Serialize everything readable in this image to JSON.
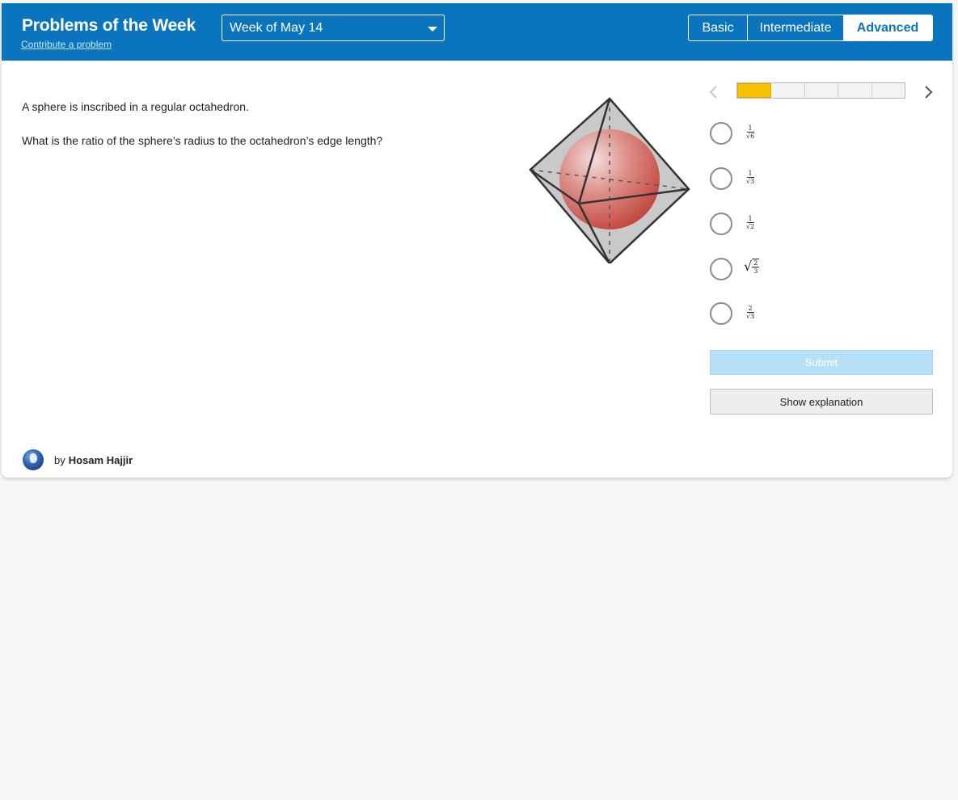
{
  "header": {
    "title": "Problems of the Week",
    "contribute_label": "Contribute a problem",
    "week_selected": "Week of May 14",
    "levels": [
      "Basic",
      "Intermediate",
      "Advanced"
    ],
    "active_level": "Advanced"
  },
  "problem": {
    "statement": "A sphere is inscribed in a regular octahedron.",
    "question": "What is the ratio of the sphere’s radius to the octahedron’s edge length?"
  },
  "progress": {
    "current": 1,
    "total": 5
  },
  "choices": [
    {
      "num": "1",
      "den": "√6"
    },
    {
      "num": "1",
      "den": "√3"
    },
    {
      "num": "1",
      "den": "√2"
    },
    {
      "sqrt_num": "2",
      "sqrt_den": "3"
    },
    {
      "num": "2",
      "den": "√3"
    }
  ],
  "actions": {
    "submit_label": "Submit",
    "explain_label": "Show explanation"
  },
  "author": {
    "by_label": "by",
    "name": "Hosam Hajjir"
  },
  "colors": {
    "header_blue": "#0a75be",
    "progress_active": "#f7c300",
    "submit_disabled": "#b6e0f6"
  }
}
